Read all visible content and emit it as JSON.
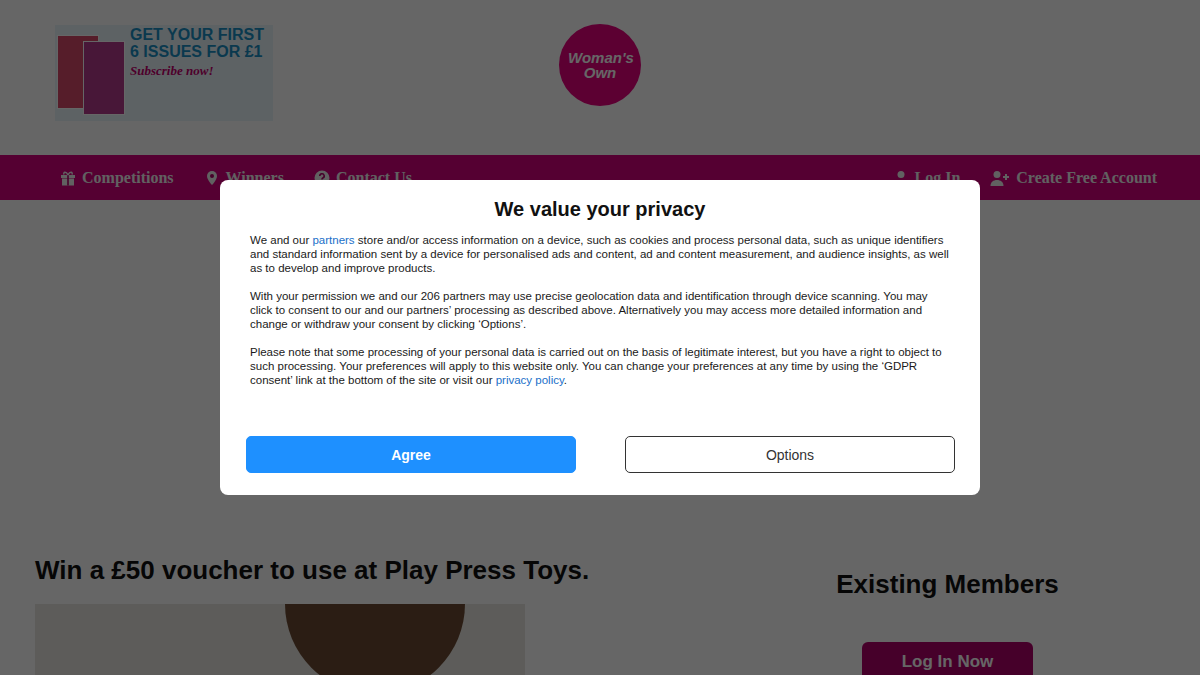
{
  "promo": {
    "headline": "GET YOUR FIRST 6 ISSUES FOR £1",
    "cta": "Subscribe now!"
  },
  "logo": "Woman's Own",
  "nav": {
    "left": [
      {
        "label": "Competitions",
        "icon": "gift"
      },
      {
        "label": "Winners",
        "icon": "pin"
      },
      {
        "label": "Contact Us",
        "icon": "question"
      }
    ],
    "right": [
      {
        "label": "Log In",
        "icon": "user"
      },
      {
        "label": "Create Free Account",
        "icon": "user-plus"
      }
    ]
  },
  "competition": {
    "title": "Win a £50 voucher to use at Play Press Toys."
  },
  "sidebar": {
    "heading": "Existing Members",
    "button": "Log In Now"
  },
  "dialog": {
    "title": "We value your privacy",
    "paragraphs": [
      [
        {
          "text": "We and our ",
          "link": false
        },
        {
          "text": "partners",
          "link": true
        },
        {
          "text": " store and/or access information on a device, such as cookies and process personal data, such as unique identifiers and standard information sent by a device for personalised ads and content, ad and content measurement, and audience insights, as well as to develop and improve products.",
          "link": false
        }
      ],
      [
        {
          "text": "With your permission we and our 206 partners may use precise geolocation data and identification through device scanning. You may click to consent to our and our partners’ processing as described above. Alternatively you may access more detailed information and change or withdraw your consent by clicking ‘Options’.",
          "link": false
        }
      ],
      [
        {
          "text": "Please note that some processing of your personal data is carried out on the basis of legitimate interest, but you have a right to object to such processing. Your preferences will apply to this website only. You can change your preferences at any time by using the ‘GDPR consent’ link at the bottom of the site or visit our ",
          "link": false
        },
        {
          "text": "privacy policy",
          "link": true
        },
        {
          "text": ".",
          "link": false
        }
      ]
    ],
    "buttons": [
      {
        "label": "Agree",
        "kind": "primary"
      },
      {
        "label": "Options",
        "kind": "secondary"
      }
    ]
  }
}
